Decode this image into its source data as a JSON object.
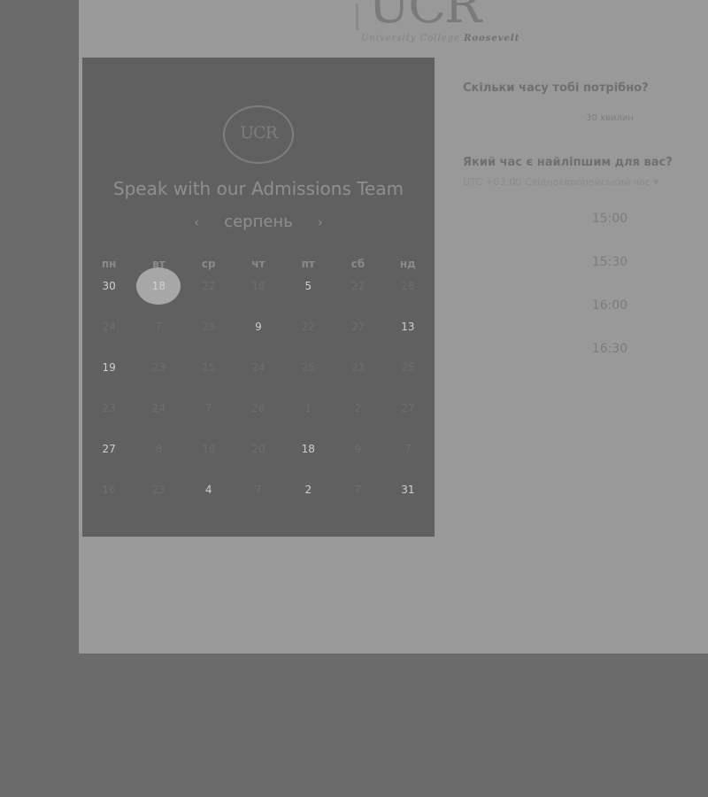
{
  "brand": {
    "logo_text": "UCR",
    "logo_sub_1": "University College",
    "logo_sub_2": "Roosevelt",
    "calendar_logo_text": "UCR"
  },
  "calendar": {
    "title": "Speak with our Admissions Team",
    "month": "серпень",
    "prev_icon": "‹",
    "next_icon": "›",
    "weekdays": [
      "пн",
      "вт",
      "ср",
      "чт",
      "пт",
      "сб",
      "нд"
    ],
    "weeks": [
      [
        "30",
        "18",
        "22",
        "18",
        "5",
        "22",
        "28"
      ],
      [
        "24",
        "7",
        "23",
        "9",
        "22",
        "27",
        "13"
      ],
      [
        "19",
        "23",
        "15",
        "24",
        "25",
        "23",
        "25"
      ],
      [
        "23",
        "24",
        "7",
        "26",
        "1",
        "2",
        "27"
      ],
      [
        "27",
        "8",
        "18",
        "20",
        "18",
        "9",
        "7"
      ],
      [
        "16",
        "23",
        "4",
        "7",
        "2",
        "7",
        "31"
      ]
    ],
    "selected": "18"
  },
  "booking": {
    "duration_question": "Скільки часу тобі потрібно?",
    "duration_value": "30 хвилин",
    "time_question": "Який час є найліпшим для вас?",
    "timezone": "UTC +03:00 Східноєвропейський час ▾",
    "slots": [
      "15:00",
      "15:30",
      "16:00",
      "16:30"
    ]
  },
  "colors": {
    "overlay": "#6b6b6b",
    "page_bg": "#999999",
    "calendar_bg": "#606060",
    "selected_day": "#a7a7a7"
  }
}
